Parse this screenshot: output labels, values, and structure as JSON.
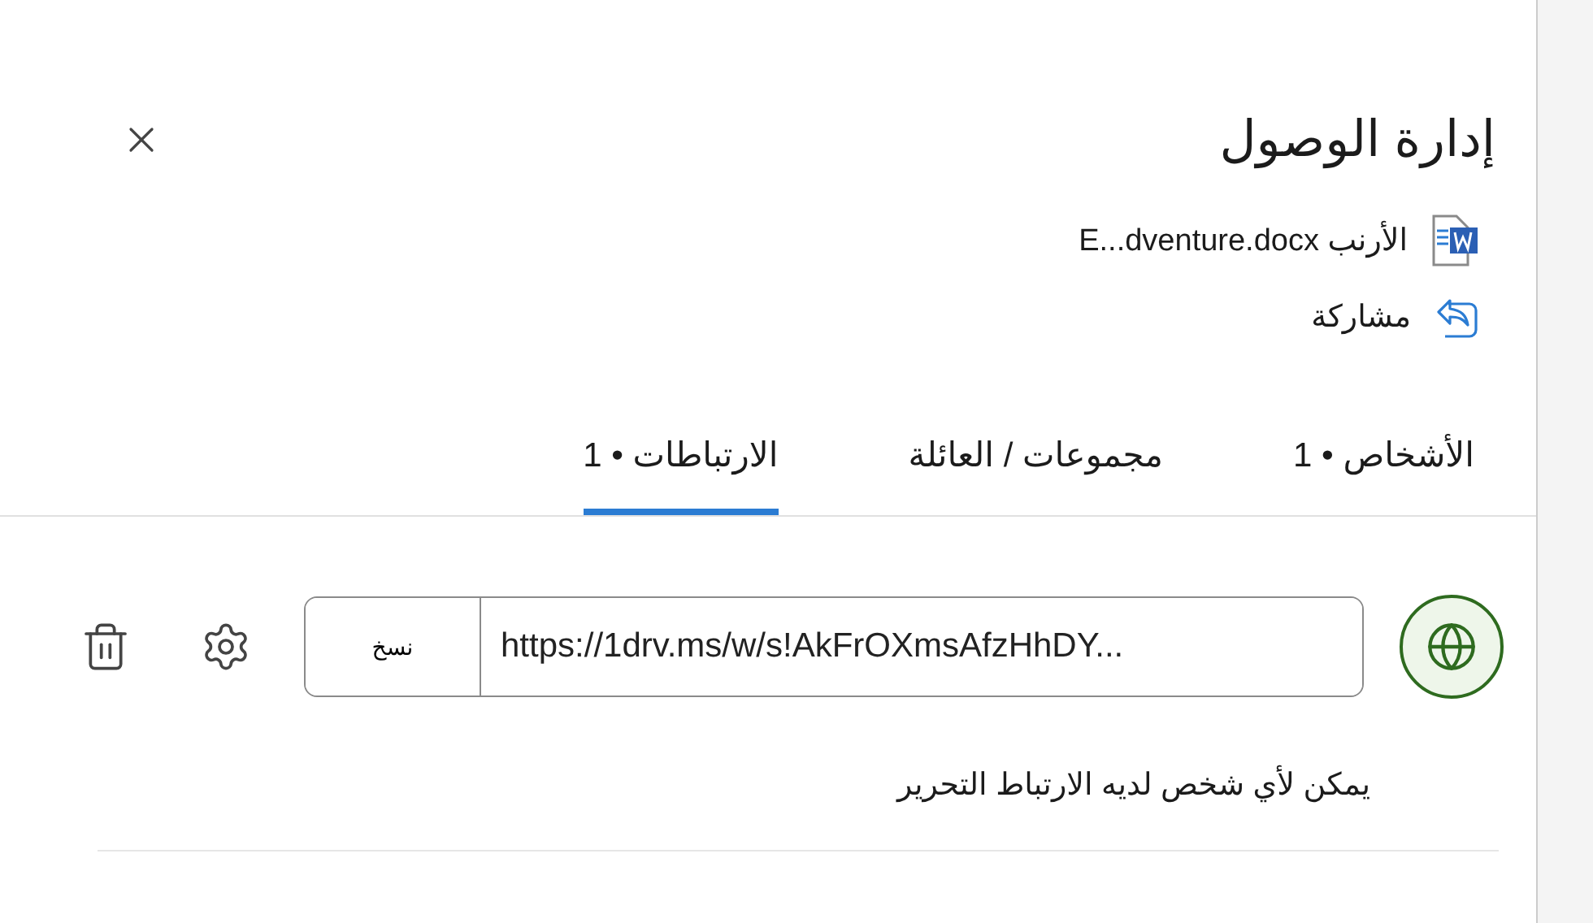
{
  "dialog": {
    "title": "إدارة الوصول"
  },
  "file": {
    "name": "الأرنب E...dventure.docx"
  },
  "share": {
    "label": "مشاركة"
  },
  "tabs": [
    {
      "label": "الأشخاص • 1",
      "selected": false
    },
    {
      "label": "مجموعات / العائلة",
      "selected": false
    },
    {
      "label": "الارتباطات • 1",
      "selected": true
    }
  ],
  "link": {
    "url": "https://1drv.ms/w/s!AkFrOXmsAfzHhDY...",
    "copy_label": "نسخ",
    "description": "يمكن لأي شخص لديه الارتباط التحرير"
  }
}
